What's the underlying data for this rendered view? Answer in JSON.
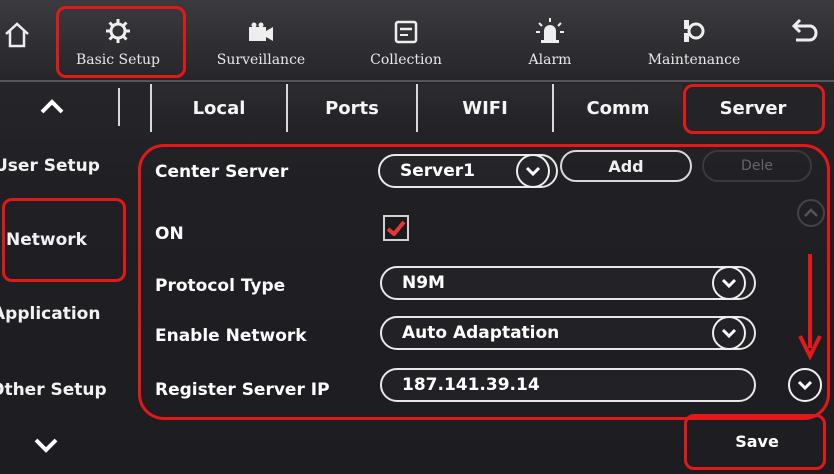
{
  "topbar": {
    "items": [
      {
        "label": "Basic Setup",
        "icon": "gear-icon"
      },
      {
        "label": "Surveillance",
        "icon": "camera-icon"
      },
      {
        "label": "Collection",
        "icon": "document-icon"
      },
      {
        "label": "Alarm",
        "icon": "alarm-light-icon"
      },
      {
        "label": "Maintenance",
        "icon": "wrench-icon"
      }
    ]
  },
  "tabs": [
    "Local",
    "Ports",
    "WIFI",
    "Comm",
    "Server"
  ],
  "sidebar": {
    "items": [
      "User Setup",
      "Network",
      "Application",
      "Other Setup"
    ]
  },
  "form": {
    "center_server": {
      "label": "Center Server",
      "value": "Server1",
      "add_label": "Add",
      "delete_label": "Dele"
    },
    "on": {
      "label": "ON",
      "checked": true
    },
    "protocol_type": {
      "label": "Protocol Type",
      "value": "N9M"
    },
    "enable_network": {
      "label": "Enable Network",
      "value": "Auto Adaptation"
    },
    "register_server_ip": {
      "label": "Register Server IP",
      "value": "187.141.39.14"
    }
  },
  "save_label": "Save",
  "colors": {
    "annotation_red": "#e31919",
    "check_red": "#e8343a",
    "background": "#202024"
  }
}
